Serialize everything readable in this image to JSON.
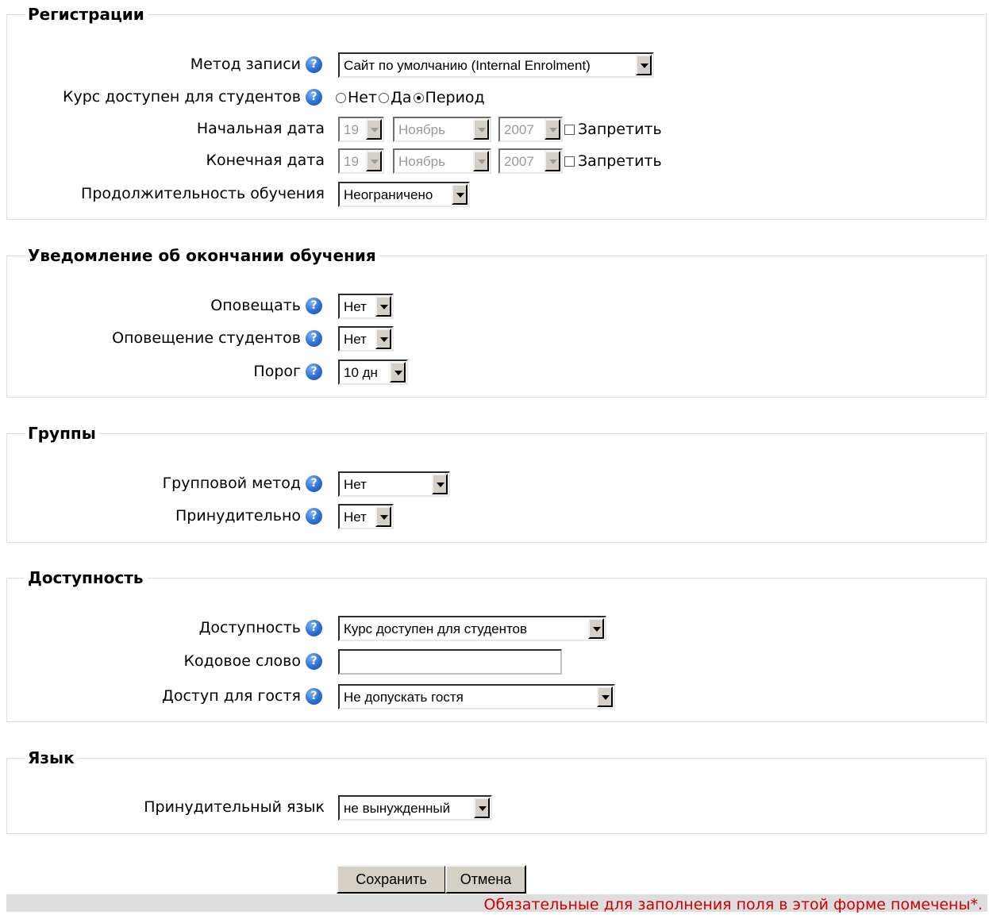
{
  "enrol": {
    "legend": "Регистрации",
    "method_label": "Метод записи",
    "method_value": "Сайт по умолчанию (Internal Enrolment)",
    "available_label": "Курс доступен для студентов",
    "opt_no": "Нет",
    "opt_yes": "Да",
    "opt_period": "Период",
    "start_label": "Начальная дата",
    "end_label": "Конечная дата",
    "day": "19",
    "month": "Ноябрь",
    "year": "2007",
    "disable_label": "Запретить",
    "duration_label": "Продолжительность обучения",
    "duration_value": "Неограничено"
  },
  "notify": {
    "legend": "Уведомление об окончании обучения",
    "notify_label": "Оповещать",
    "notify_value": "Нет",
    "students_label": "Оповещение студентов",
    "students_value": "Нет",
    "threshold_label": "Порог",
    "threshold_value": "10 дн"
  },
  "groups": {
    "legend": "Группы",
    "mode_label": "Групповой метод",
    "mode_value": "Нет",
    "force_label": "Принудительно",
    "force_value": "Нет"
  },
  "availability": {
    "legend": "Доступность",
    "avail_label": "Доступность",
    "avail_value": "Курс доступен для студентов",
    "key_label": "Кодовое слово",
    "key_value": "",
    "guest_label": "Доступ для гостя",
    "guest_value": "Не допускать гостя"
  },
  "language": {
    "legend": "Язык",
    "lang_label": "Принудительный язык",
    "lang_value": "не вынужденный"
  },
  "buttons": {
    "save": "Сохранить",
    "cancel": "Отмена"
  },
  "footer": {
    "required_note": "Обязательные для заполнения поля в этой форме помечены",
    "required_mark": "*."
  },
  "icons": {
    "help": "help-icon"
  }
}
